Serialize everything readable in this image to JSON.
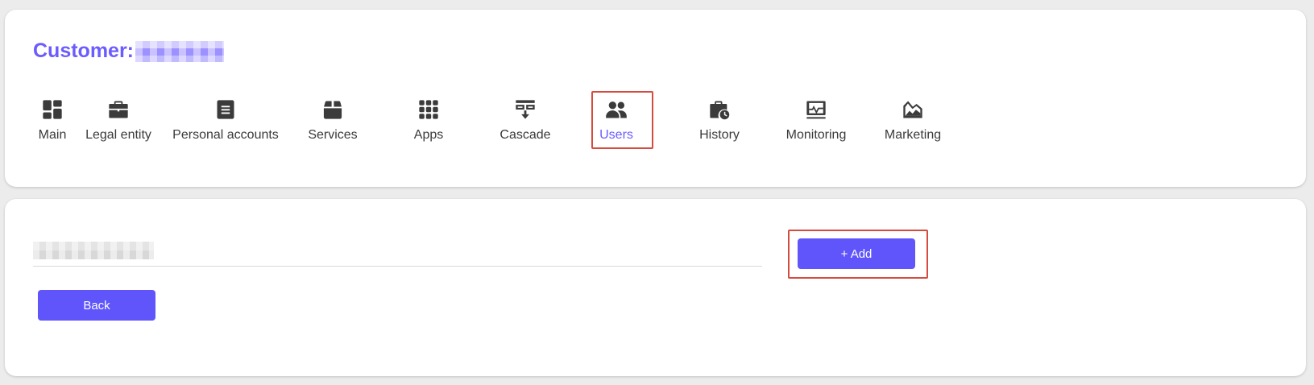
{
  "header": {
    "title_prefix": "Customer:"
  },
  "tabs": [
    {
      "label": "Main",
      "icon": "dashboard-icon"
    },
    {
      "label": "Legal entity",
      "icon": "briefcase-icon"
    },
    {
      "label": "Personal accounts",
      "icon": "document-icon"
    },
    {
      "label": "Services",
      "icon": "box-icon"
    },
    {
      "label": "Apps",
      "icon": "grid-icon"
    },
    {
      "label": "Cascade",
      "icon": "cascade-icon"
    },
    {
      "label": "Users",
      "icon": "users-icon",
      "active": true
    },
    {
      "label": "History",
      "icon": "briefcase-clock-icon"
    },
    {
      "label": "Monitoring",
      "icon": "monitor-pulse-icon"
    },
    {
      "label": "Marketing",
      "icon": "chart-area-icon"
    }
  ],
  "actions": {
    "add_label": "+ Add",
    "back_label": "Back"
  },
  "colors": {
    "accent": "#6b5cff",
    "button": "#5f55fb",
    "highlight": "#d44b3f",
    "text": "#3b3b3b"
  }
}
